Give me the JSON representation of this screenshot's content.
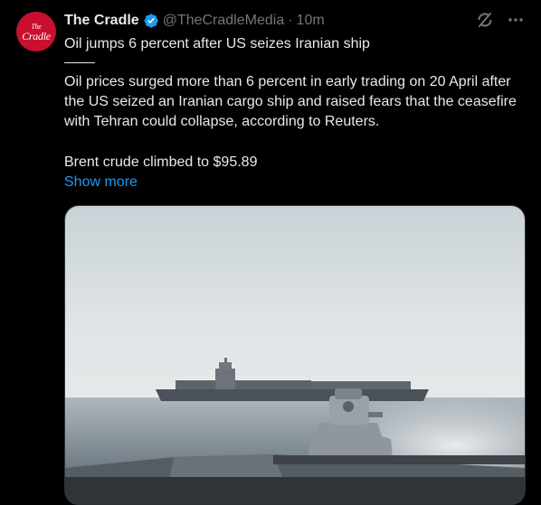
{
  "tweet": {
    "display_name": "The Cradle",
    "handle": "@TheCradleMedia",
    "separator": "·",
    "time": "10m",
    "avatar": {
      "line1": "The",
      "line2": "Cradle",
      "bg_color": "#c8102e"
    },
    "verified": true,
    "headline": "Oil jumps 6 percent after US seizes Iranian ship",
    "body": "Oil prices surged more than 6 percent in early trading on 20 April after the US seized an Iranian cargo ship and raised fears that the ceasefire with Tehran could collapse, according to Reuters.",
    "brent_line": "Brent crude climbed to $95.89",
    "show_more": "Show more",
    "media": {
      "icon": "photo",
      "subject": "cargo-ship-at-sea"
    }
  },
  "colors": {
    "background": "#000000",
    "text": "#e7e9ea",
    "secondary": "#71767b",
    "accent": "#1d9bf0"
  },
  "icons": {
    "verified": "verified-badge-icon",
    "grok": "grok-icon",
    "more": "more-icon"
  }
}
